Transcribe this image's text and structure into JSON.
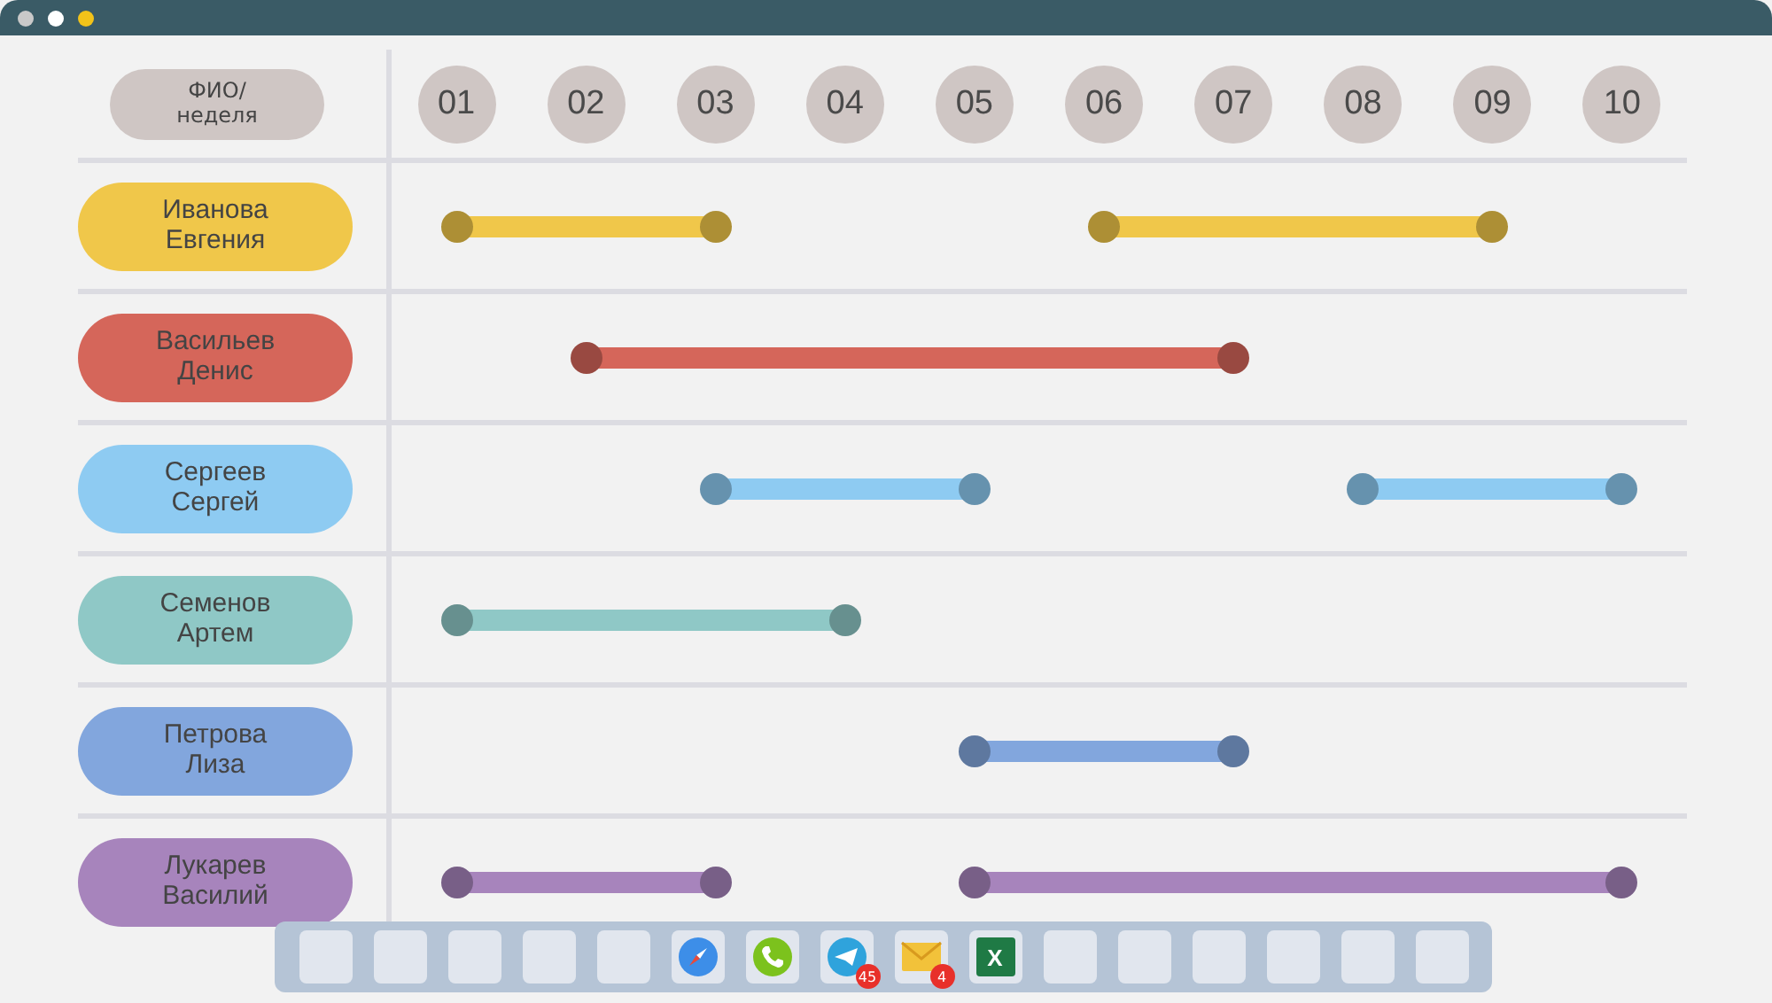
{
  "header": {
    "label": "ФИО/\nнеделя"
  },
  "weeks": [
    "01",
    "02",
    "03",
    "04",
    "05",
    "06",
    "07",
    "08",
    "09",
    "10"
  ],
  "rows": [
    {
      "name": "Иванова\nЕвгения",
      "color": "#f0c74a",
      "cells": [
        {
          "kind": "start"
        },
        {
          "kind": "middle"
        },
        {
          "kind": "end"
        },
        {
          "kind": "empty"
        },
        {
          "kind": "empty"
        },
        {
          "kind": "start"
        },
        {
          "kind": "middle"
        },
        {
          "kind": "middle"
        },
        {
          "kind": "end"
        },
        {
          "kind": "empty"
        }
      ]
    },
    {
      "name": "Васильев\nДенис",
      "color": "#d5665a",
      "cells": [
        {
          "kind": "empty"
        },
        {
          "kind": "start"
        },
        {
          "kind": "middle"
        },
        {
          "kind": "middle"
        },
        {
          "kind": "middle"
        },
        {
          "kind": "middle"
        },
        {
          "kind": "end"
        },
        {
          "kind": "empty"
        },
        {
          "kind": "empty"
        },
        {
          "kind": "empty"
        }
      ]
    },
    {
      "name": "Сергеев\nСергей",
      "color": "#8ecbf2",
      "cells": [
        {
          "kind": "empty"
        },
        {
          "kind": "empty"
        },
        {
          "kind": "start"
        },
        {
          "kind": "middle"
        },
        {
          "kind": "end"
        },
        {
          "kind": "empty"
        },
        {
          "kind": "empty"
        },
        {
          "kind": "start"
        },
        {
          "kind": "middle"
        },
        {
          "kind": "end"
        }
      ]
    },
    {
      "name": "Семенов\nАртем",
      "color": "#8fc8c6",
      "cells": [
        {
          "kind": "start"
        },
        {
          "kind": "middle"
        },
        {
          "kind": "middle"
        },
        {
          "kind": "end"
        },
        {
          "kind": "empty"
        },
        {
          "kind": "empty"
        },
        {
          "kind": "empty"
        },
        {
          "kind": "empty"
        },
        {
          "kind": "empty"
        },
        {
          "kind": "empty"
        }
      ]
    },
    {
      "name": "Петрова\nЛиза",
      "color": "#82a6dd",
      "cells": [
        {
          "kind": "empty"
        },
        {
          "kind": "empty"
        },
        {
          "kind": "empty"
        },
        {
          "kind": "empty"
        },
        {
          "kind": "start"
        },
        {
          "kind": "middle"
        },
        {
          "kind": "end"
        },
        {
          "kind": "empty"
        },
        {
          "kind": "empty"
        },
        {
          "kind": "empty"
        }
      ]
    },
    {
      "name": "Лукарев\nВасилий",
      "color": "#a784bc",
      "cells": [
        {
          "kind": "start"
        },
        {
          "kind": "middle"
        },
        {
          "kind": "end"
        },
        {
          "kind": "empty"
        },
        {
          "kind": "start"
        },
        {
          "kind": "middle"
        },
        {
          "kind": "middle"
        },
        {
          "kind": "middle"
        },
        {
          "kind": "middle"
        },
        {
          "kind": "end"
        }
      ]
    }
  ],
  "dock": [
    {
      "kind": "empty"
    },
    {
      "kind": "empty"
    },
    {
      "kind": "empty"
    },
    {
      "kind": "empty"
    },
    {
      "kind": "empty"
    },
    {
      "kind": "compass"
    },
    {
      "kind": "phone"
    },
    {
      "kind": "send",
      "badge": "45"
    },
    {
      "kind": "mail",
      "badge": "4"
    },
    {
      "kind": "sheet",
      "label": "X"
    },
    {
      "kind": "empty"
    },
    {
      "kind": "empty"
    },
    {
      "kind": "empty"
    },
    {
      "kind": "empty"
    },
    {
      "kind": "empty"
    },
    {
      "kind": "empty"
    }
  ]
}
